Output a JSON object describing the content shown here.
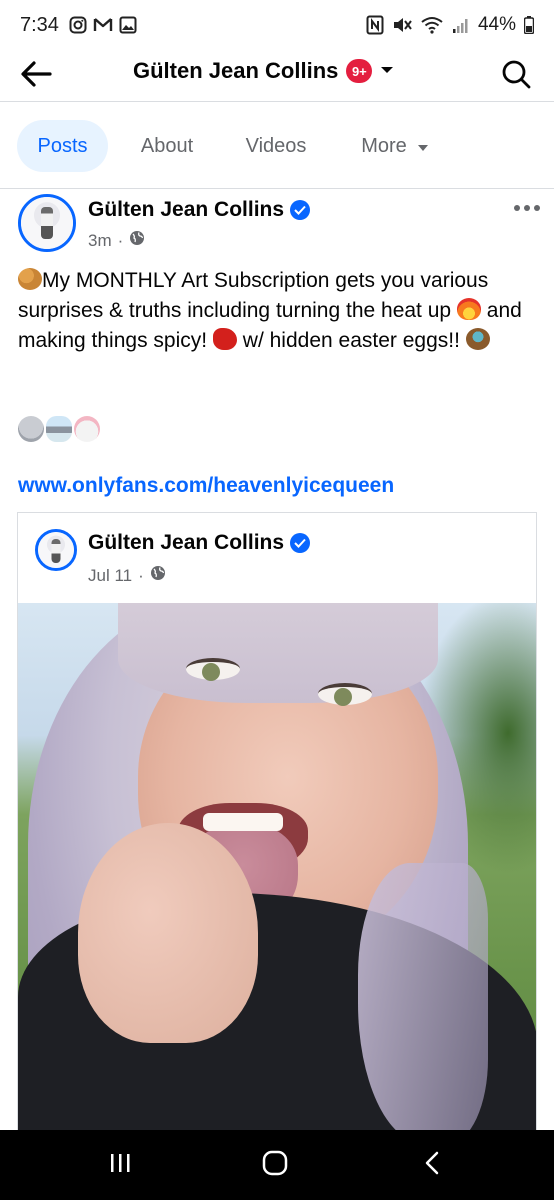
{
  "status_bar": {
    "time": "7:34",
    "battery": "44%",
    "left_icons": [
      "instagram-icon",
      "gmail-icon",
      "gallery-icon"
    ],
    "right_icons": [
      "nfc-icon",
      "mute-icon",
      "wifi-icon",
      "signal-icon",
      "battery-icon"
    ]
  },
  "header": {
    "title": "Gülten Jean Collins",
    "badge": "9+",
    "back_icon": "arrow-left-icon",
    "search_icon": "search-icon",
    "dropdown_icon": "chevron-down-icon"
  },
  "tabs": [
    {
      "label": "Posts",
      "active": true
    },
    {
      "label": "About",
      "active": false
    },
    {
      "label": "Videos",
      "active": false
    },
    {
      "label": "More",
      "active": false
    }
  ],
  "post": {
    "author": "Gülten Jean Collins",
    "time": "3m",
    "privacy_icon": "globe-icon",
    "text_line1": "My MONTHLY Art Subscription gets you various surprises & truths including turning the heat up",
    "text_line2": "and making things spicy!",
    "text_line3": "w/ hidden easter eggs!!",
    "emoji_line": [
      "alien-emoji",
      "ufo-emoji",
      "rabbit-emoji"
    ],
    "link": "www.onlyfans.com/heavenlyicequeen",
    "shared": {
      "author": "Gülten Jean Collins",
      "date": "Jul 11",
      "privacy_icon": "globe-icon"
    }
  },
  "nav": {
    "recents_icon": "recent-apps-icon",
    "home_icon": "home-icon",
    "back_icon": "back-icon"
  },
  "colors": {
    "accent": "#0866ff",
    "badge": "#e41e3f",
    "secondary_text": "#65676b",
    "tab_active_bg": "#e7f3ff"
  }
}
